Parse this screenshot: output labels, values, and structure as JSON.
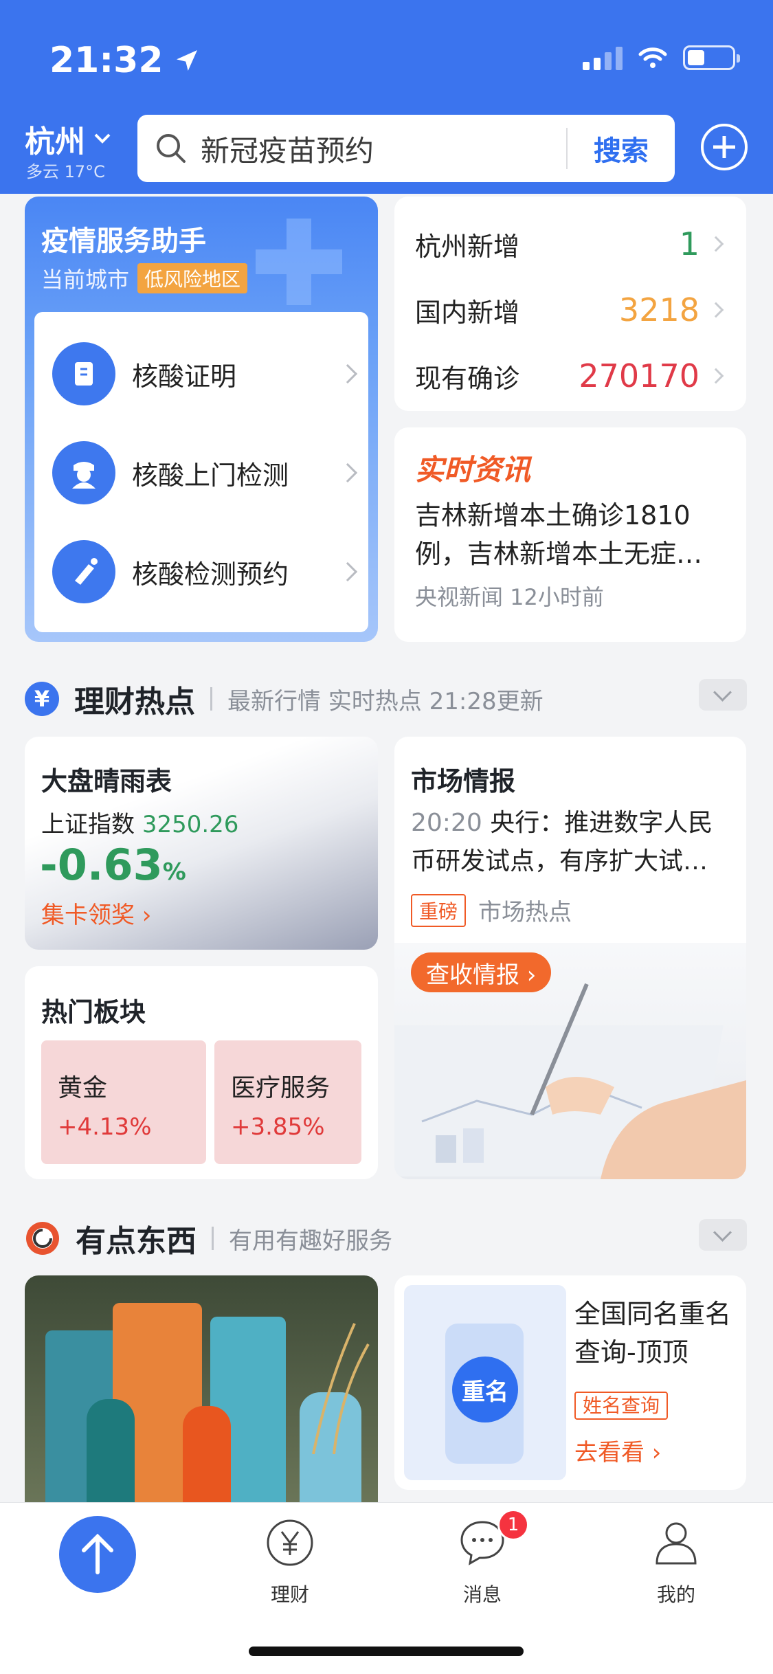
{
  "status_bar": {
    "time": "21:32"
  },
  "header": {
    "city": "杭州",
    "weather": "多云 17°C",
    "search_placeholder": "新冠疫苗预约",
    "search_button": "搜索"
  },
  "epidemic": {
    "title": "疫情服务助手",
    "city_label": "当前城市",
    "risk_badge": "低风险地区",
    "services": [
      {
        "label": "核酸证明"
      },
      {
        "label": "核酸上门检测"
      },
      {
        "label": "核酸检测预约"
      }
    ]
  },
  "stats": [
    {
      "name": "杭州新增",
      "value": "1",
      "color": "#2f9a5c"
    },
    {
      "name": "国内新增",
      "value": "3218",
      "color": "#f3a441"
    },
    {
      "name": "现有确诊",
      "value": "270170",
      "color": "#e03a48"
    }
  ],
  "news": {
    "tag": "实时资讯",
    "title": "吉林新增本土确诊1810例，吉林新增本土无症…",
    "meta": "央视新闻 12小时前"
  },
  "finance_section": {
    "title": "理财热点",
    "subtitle": "最新行情 实时热点 21:28更新"
  },
  "market": {
    "title": "大盘晴雨表",
    "index_label": "上证指数",
    "index_value": "3250.26",
    "change": "-0.63",
    "percent": "%",
    "link": "集卡领奖 ›"
  },
  "market_intel": {
    "title": "市场情报",
    "time": "20:20",
    "body": "央行：推进数字人民币研发试点，有序扩大试…",
    "tag": "重磅",
    "category": "市场热点",
    "button": "查收情报 ›"
  },
  "hot_sectors": {
    "title": "热门板块",
    "items": [
      {
        "name": "黄金",
        "change": "+4.13%"
      },
      {
        "name": "医疗服务",
        "change": "+3.85%"
      }
    ]
  },
  "goods_section": {
    "title": "有点东西",
    "subtitle": "有用有趣好服务"
  },
  "name_query": {
    "badge": "重名",
    "title": "全国同名重名查询-顶顶",
    "tag": "姓名查询",
    "link": "去看看 ›"
  },
  "tabbar": {
    "items": [
      {
        "label": "理财"
      },
      {
        "label": "消息"
      },
      {
        "label": "我的"
      }
    ],
    "message_badge": "1"
  }
}
